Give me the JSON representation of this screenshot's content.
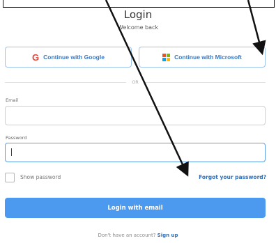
{
  "login": {
    "title": "Login",
    "subtitle": "Welcome back",
    "google_label": "Continue with Google",
    "microsoft_label": "Continue with Microsoft",
    "divider": "OR",
    "email_label": "Email",
    "email_value": "",
    "password_label": "Password",
    "password_value": "",
    "show_password_label": "Show password",
    "show_password_checked": false,
    "forgot_label": "Forgot your password?",
    "submit_label": "Login with email",
    "footer_text": "Don't have an account?",
    "signup_label": "Sign up"
  },
  "icons": {
    "google": "google-g-icon",
    "microsoft": "microsoft-logo-icon",
    "annotation": "arrow-annotation"
  },
  "colors": {
    "accent": "#4b9af0",
    "link": "#2f6fb8",
    "outline": "#9cc3ee",
    "google_g": "#ea4335",
    "ms_red": "#f25022",
    "ms_green": "#7fba00",
    "ms_blue": "#00a4ef",
    "ms_yellow": "#ffb900"
  }
}
